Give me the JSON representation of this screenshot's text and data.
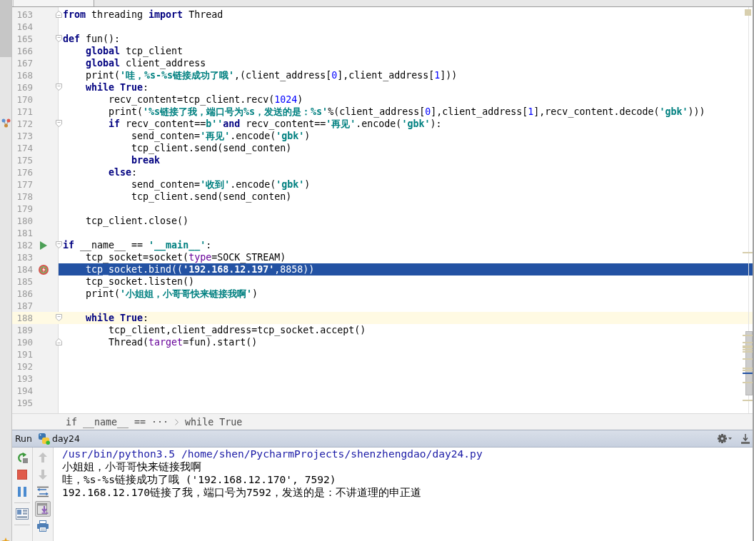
{
  "editor": {
    "lines": [
      {
        "number": "163",
        "fold_marker": {
          "kind": "end"
        },
        "selected": false,
        "current": false,
        "tokens": [
          {
            "kind": "keyword",
            "text": "from"
          },
          {
            "kind": "plain",
            "text": " threading "
          },
          {
            "kind": "keyword",
            "text": "import"
          },
          {
            "kind": "plain",
            "text": " Thread"
          }
        ]
      },
      {
        "number": "164",
        "selected": false,
        "current": false
      },
      {
        "number": "165",
        "fold_marker": {
          "kind": "start"
        },
        "selected": false,
        "current": false,
        "tokens": [
          {
            "kind": "keyword",
            "text": "def"
          },
          {
            "kind": "plain",
            "text": " fun():"
          }
        ]
      },
      {
        "number": "166",
        "selected": false,
        "current": false,
        "tokens": [
          {
            "kind": "keyword",
            "text": "    global"
          },
          {
            "kind": "plain",
            "text": " tcp_client"
          }
        ]
      },
      {
        "number": "167",
        "selected": false,
        "current": false,
        "tokens": [
          {
            "kind": "keyword",
            "text": "    global"
          },
          {
            "kind": "plain",
            "text": " client_address"
          }
        ]
      },
      {
        "number": "168",
        "selected": false,
        "current": false,
        "tokens": [
          {
            "kind": "plain",
            "text": "    print("
          },
          {
            "kind": "string",
            "text": "'哇，%s-%s链接成功了哦'"
          },
          {
            "kind": "plain",
            "text": ",(client_address["
          },
          {
            "kind": "number",
            "text": "0"
          },
          {
            "kind": "plain",
            "text": "],client_address["
          },
          {
            "kind": "number",
            "text": "1"
          },
          {
            "kind": "plain",
            "text": "]))"
          }
        ]
      },
      {
        "number": "169",
        "fold_marker": {
          "kind": "start"
        },
        "selected": false,
        "current": false,
        "tokens": [
          {
            "kind": "keyword",
            "text": "    while"
          },
          {
            "kind": "keyword",
            "text": " True"
          },
          {
            "kind": "plain",
            "text": ":"
          }
        ]
      },
      {
        "number": "170",
        "selected": false,
        "current": false,
        "tokens": [
          {
            "kind": "plain",
            "text": "        recv_content=tcp_client.recv("
          },
          {
            "kind": "number",
            "text": "1024"
          },
          {
            "kind": "plain",
            "text": ")"
          }
        ]
      },
      {
        "number": "171",
        "selected": false,
        "current": false,
        "tokens": [
          {
            "kind": "plain",
            "text": "        print("
          },
          {
            "kind": "string",
            "text": "'%s链接了我，端口号为%s，发送的是：%s'"
          },
          {
            "kind": "plain",
            "text": "%(client_address["
          },
          {
            "kind": "number",
            "text": "0"
          },
          {
            "kind": "plain",
            "text": "],client_address["
          },
          {
            "kind": "number",
            "text": "1"
          },
          {
            "kind": "plain",
            "text": "],recv_content.decode("
          },
          {
            "kind": "string",
            "text": "'gbk'"
          },
          {
            "kind": "plain",
            "text": ")))"
          }
        ]
      },
      {
        "number": "172",
        "fold_marker": {
          "kind": "start"
        },
        "selected": false,
        "current": false,
        "tokens": [
          {
            "kind": "keyword",
            "text": "        if"
          },
          {
            "kind": "plain",
            "text": " recv_content=="
          },
          {
            "kind": "string",
            "text": "b''"
          },
          {
            "kind": "keyword",
            "text": "and"
          },
          {
            "kind": "plain",
            "text": " recv_content=="
          },
          {
            "kind": "string",
            "text": "'再见'"
          },
          {
            "kind": "plain",
            "text": ".encode("
          },
          {
            "kind": "string",
            "text": "'gbk'"
          },
          {
            "kind": "plain",
            "text": "):"
          }
        ]
      },
      {
        "number": "173",
        "selected": false,
        "current": false,
        "tokens": [
          {
            "kind": "plain",
            "text": "            send_conten="
          },
          {
            "kind": "string",
            "text": "'再见'"
          },
          {
            "kind": "plain",
            "text": ".encode("
          },
          {
            "kind": "string",
            "text": "'gbk'"
          },
          {
            "kind": "plain",
            "text": ")"
          }
        ]
      },
      {
        "number": "174",
        "selected": false,
        "current": false,
        "tokens": [
          {
            "kind": "plain",
            "text": "            tcp_client.send(send_conten)"
          }
        ]
      },
      {
        "number": "175",
        "selected": false,
        "current": false,
        "tokens": [
          {
            "kind": "keyword",
            "text": "            break"
          }
        ]
      },
      {
        "number": "176",
        "selected": false,
        "current": false,
        "tokens": [
          {
            "kind": "keyword",
            "text": "        else"
          },
          {
            "kind": "plain",
            "text": ":"
          }
        ]
      },
      {
        "number": "177",
        "selected": false,
        "current": false,
        "tokens": [
          {
            "kind": "plain",
            "text": "            send_conten="
          },
          {
            "kind": "string",
            "text": "'收到'"
          },
          {
            "kind": "plain",
            "text": ".encode("
          },
          {
            "kind": "string",
            "text": "'gbk'"
          },
          {
            "kind": "plain",
            "text": ")"
          }
        ]
      },
      {
        "number": "178",
        "selected": false,
        "current": false,
        "tokens": [
          {
            "kind": "plain",
            "text": "            tcp_client.send(send_conten)"
          }
        ]
      },
      {
        "number": "179",
        "selected": false,
        "current": false
      },
      {
        "number": "180",
        "selected": false,
        "current": false,
        "tokens": [
          {
            "kind": "plain",
            "text": "    tcp_client.close()"
          }
        ]
      },
      {
        "number": "181",
        "selected": false,
        "current": false
      },
      {
        "number": "182",
        "fold_marker": {
          "kind": "start"
        },
        "gutter_marker": {
          "kind": "run"
        },
        "selected": false,
        "current": false,
        "tokens": [
          {
            "kind": "keyword",
            "text": "if"
          },
          {
            "kind": "plain",
            "text": " __name__ == "
          },
          {
            "kind": "string",
            "text": "'__main__'"
          },
          {
            "kind": "plain",
            "text": ":"
          }
        ]
      },
      {
        "number": "183",
        "selected": false,
        "current": false,
        "tokens": [
          {
            "kind": "plain",
            "text": "    tcp_socket=socket("
          },
          {
            "kind": "param",
            "text": "type"
          },
          {
            "kind": "plain",
            "text": "=SOCK_STREAM)"
          }
        ]
      },
      {
        "number": "184",
        "gutter_marker": {
          "kind": "breakpoint"
        },
        "selected": true,
        "current": false,
        "tokens": [
          {
            "kind": "plain",
            "text": "    tcp_socket.bind(("
          },
          {
            "kind": "string",
            "text": "'192.168.12.197'"
          },
          {
            "kind": "plain",
            "text": ","
          },
          {
            "kind": "number",
            "text": "8858"
          },
          {
            "kind": "plain",
            "text": "))"
          }
        ]
      },
      {
        "number": "185",
        "selected": false,
        "current": false,
        "tokens": [
          {
            "kind": "plain",
            "text": "    tcp_socket.listen()"
          }
        ]
      },
      {
        "number": "186",
        "selected": false,
        "current": false,
        "tokens": [
          {
            "kind": "plain",
            "text": "    print("
          },
          {
            "kind": "string",
            "text": "'小姐姐，小哥哥快来链接我啊'"
          },
          {
            "kind": "plain",
            "text": ")"
          }
        ]
      },
      {
        "number": "187",
        "selected": false,
        "current": false
      },
      {
        "number": "188",
        "fold_marker": {
          "kind": "start"
        },
        "selected": false,
        "current": true,
        "tokens": [
          {
            "kind": "keyword",
            "text": "    while"
          },
          {
            "kind": "keyword",
            "text": " True"
          },
          {
            "kind": "plain",
            "text": ":"
          }
        ]
      },
      {
        "number": "189",
        "selected": false,
        "current": false,
        "tokens": [
          {
            "kind": "plain",
            "text": "        tcp_client,client_address=tcp_socket.accept()"
          }
        ]
      },
      {
        "number": "190",
        "fold_marker": {
          "kind": "end"
        },
        "selected": false,
        "current": false,
        "tokens": [
          {
            "kind": "plain",
            "text": "        Thread("
          },
          {
            "kind": "param",
            "text": "target"
          },
          {
            "kind": "plain",
            "text": "=fun).start()"
          }
        ]
      },
      {
        "number": "191",
        "selected": false,
        "current": false
      },
      {
        "number": "192",
        "selected": false,
        "current": false
      },
      {
        "number": "193",
        "selected": false,
        "current": false
      },
      {
        "number": "194",
        "selected": false,
        "current": false
      },
      {
        "number": "195",
        "selected": false,
        "current": false
      }
    ]
  },
  "breadcrumb": [
    {
      "text": "if __name__ == ···"
    },
    {
      "text": "while True"
    }
  ],
  "run_panel": {
    "title": "Run",
    "configuration": "day24",
    "control_groups": [
      {
        "controls": [
          {
            "kind": "rerun"
          },
          {
            "kind": "stop"
          },
          {
            "kind": "pause"
          }
        ]
      },
      {
        "controls": [
          {
            "kind": "layout"
          }
        ]
      }
    ],
    "output_controls": [
      {
        "kind": "up",
        "disabled": true,
        "on": false
      },
      {
        "kind": "down",
        "disabled": true,
        "on": false
      },
      {
        "kind": "wrap",
        "disabled": false,
        "on": false
      },
      {
        "kind": "scroll_end",
        "disabled": false,
        "on": true
      },
      {
        "kind": "print",
        "disabled": false,
        "on": false
      }
    ],
    "console": [
      {
        "kind": "command",
        "text": "/usr/bin/python3.5 /home/shen/PycharmProjects/shenzhengdao/day24.py"
      },
      {
        "kind": "output",
        "text": "小姐姐，小哥哥快来链接我啊"
      },
      {
        "kind": "output",
        "text": "哇，%s-%s链接成功了哦 ('192.168.12.170', 7592)"
      },
      {
        "kind": "output",
        "text": "192.168.12.170链接了我，端口号为7592，发送的是：不讲道理的申正道"
      }
    ]
  }
}
